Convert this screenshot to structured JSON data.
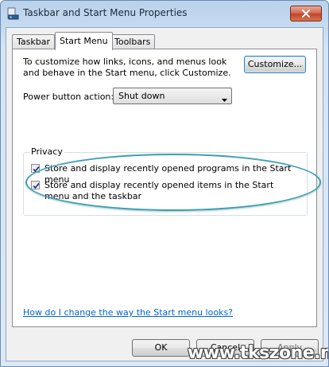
{
  "window": {
    "title": "Taskbar and Start Menu Properties"
  },
  "tabs": [
    {
      "label": "Taskbar"
    },
    {
      "label": "Start Menu"
    },
    {
      "label": "Toolbars"
    }
  ],
  "start_menu": {
    "description": "To customize how links, icons, and menus look and behave in the Start menu, click Customize.",
    "customize_label": "Customize...",
    "power_label": "Power button action:",
    "power_value": "Shut down",
    "privacy": {
      "title": "Privacy",
      "checkboxes": [
        {
          "label": "Store and display recently opened programs in the Start menu",
          "checked": true
        },
        {
          "label": "Store and display recently opened items in the Start menu and the taskbar",
          "checked": true
        }
      ]
    },
    "help_link": "How do I change the way the Start menu looks?"
  },
  "buttons": {
    "ok": "OK",
    "cancel": "Cancel",
    "apply": "Apply"
  },
  "watermark": "www.tkszone.net",
  "colors": {
    "link": "#0066cc",
    "annotation_ellipse": "#3d9fb0",
    "close_button": "#c2432a"
  }
}
